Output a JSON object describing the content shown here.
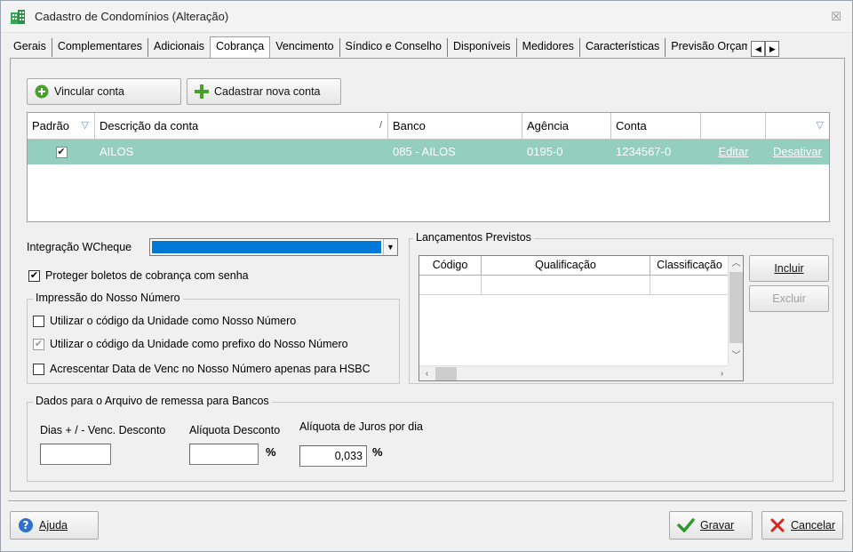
{
  "window": {
    "title": "Cadastro de Condomínios (Alteração)",
    "close_glyph": "☒"
  },
  "tabs": [
    {
      "label": "Gerais"
    },
    {
      "label": "Complementares"
    },
    {
      "label": "Adicionais"
    },
    {
      "label": "Cobrança",
      "active": true
    },
    {
      "label": "Vencimento"
    },
    {
      "label": "Síndico e Conselho"
    },
    {
      "label": "Disponíveis"
    },
    {
      "label": "Medidores"
    },
    {
      "label": "Características"
    },
    {
      "label": "Previsão Orçam"
    }
  ],
  "accounts": {
    "link_button": "Vincular conta",
    "new_button": "Cadastrar nova conta",
    "columns": [
      "Padrão",
      "Descrição da conta",
      "Banco",
      "Agência",
      "Conta"
    ],
    "rows": [
      {
        "checked": true,
        "descricao": "AILOS",
        "banco": "085 - AILOS",
        "agencia": "0195-0",
        "conta": "1234567-0",
        "editar": "Editar",
        "desativar": "Desativar"
      }
    ]
  },
  "integration": {
    "label": "Integração WCheque",
    "value": ""
  },
  "protect": {
    "label": "Proteger boletos de cobrança com senha",
    "checked": true
  },
  "nosso_numero": {
    "legend": "Impressão do Nosso Número",
    "options": [
      {
        "label": "Utilizar o código da Unidade como Nosso Número",
        "checked": false
      },
      {
        "label": "Utilizar o código da Unidade como prefixo do Nosso Número",
        "checked": true,
        "disabled": true
      },
      {
        "label": "Acrescentar Data de Venc no Nosso Número apenas para HSBC",
        "checked": false
      }
    ]
  },
  "lancamentos": {
    "legend": "Lançamentos Previstos",
    "columns": [
      "Código",
      "Qualificação",
      "Classificação"
    ],
    "include_button": "Incluir",
    "exclude_button": "Excluir"
  },
  "remessa": {
    "legend": "Dados para o Arquivo de remessa para Bancos",
    "dias_label": "Dias + / - Venc. Desconto",
    "dias_value": "",
    "aliquota_desc_label": "Alíquota Desconto",
    "aliquota_desc_value": "",
    "aliquota_juros_label": "Alíquota de Juros por dia",
    "aliquota_juros_value": "0,033",
    "percent": "%"
  },
  "footer": {
    "help_button": "Ajuda",
    "save_button": "Gravar",
    "cancel_button": "Cancelar"
  },
  "colors": {
    "selected_row": "#93cebf",
    "combo_selection": "#0078d7"
  }
}
